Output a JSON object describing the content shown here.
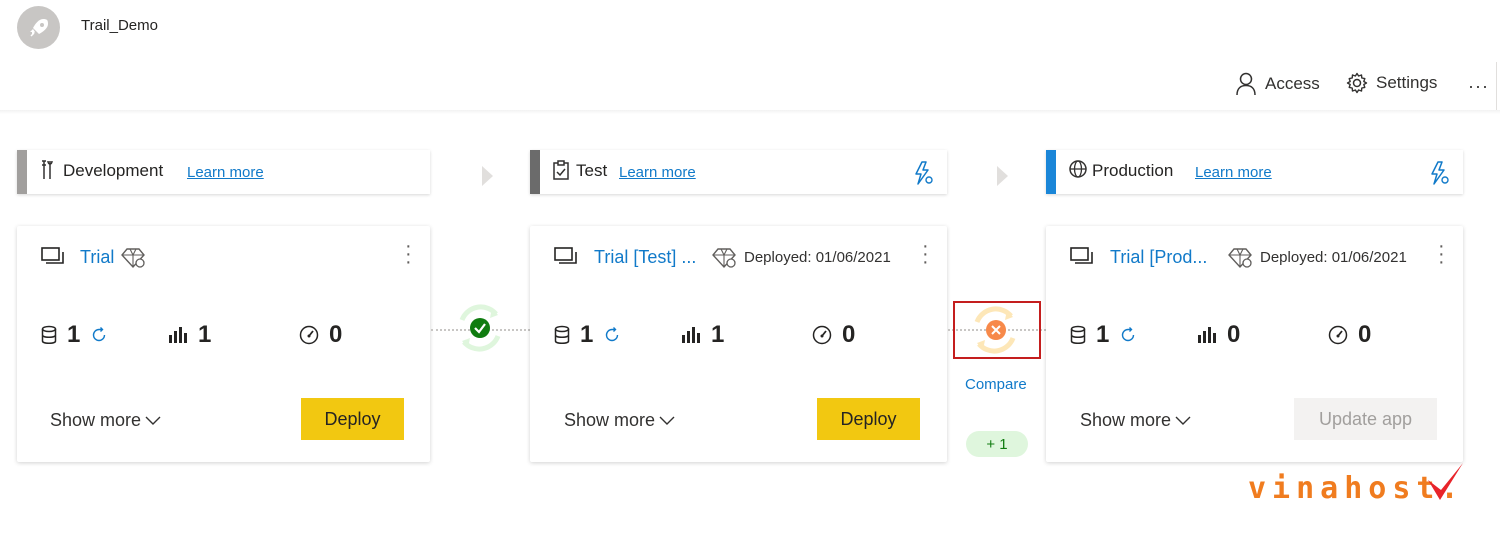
{
  "header": {
    "app_title": "Trail_Demo",
    "access_label": "Access",
    "settings_label": "Settings",
    "more_label": "···"
  },
  "stages": [
    {
      "name": "Development",
      "learn_more": "Learn more",
      "color": "#a19f9d"
    },
    {
      "name": "Test",
      "learn_more": "Learn more",
      "color": "#6b6b6b"
    },
    {
      "name": "Production",
      "learn_more": "Learn more",
      "color": "#1a86d8"
    }
  ],
  "cards": [
    {
      "workspace": "Trial",
      "deployed": "",
      "datasets": "1",
      "reports": "1",
      "dashboards": "0",
      "show_more": "Show more",
      "action": "Deploy"
    },
    {
      "workspace": "Trial [Test] ...",
      "deployed": "Deployed: 01/06/2021",
      "datasets": "1",
      "reports": "1",
      "dashboards": "0",
      "show_more": "Show more",
      "action": "Deploy"
    },
    {
      "workspace": "Trial [Prod...",
      "deployed": "Deployed: 01/06/2021",
      "datasets": "1",
      "reports": "0",
      "dashboards": "0",
      "show_more": "Show more",
      "action": "Update app"
    }
  ],
  "compare": {
    "label": "Compare",
    "diff_badge": "+ 1"
  },
  "watermark": "vinahost.",
  "colors": {
    "accent_blue": "#117ac9",
    "deploy_yellow": "#f2c811",
    "success_green": "#107c10",
    "warning_orange": "#f7894a",
    "highlight_red": "#c41e1e"
  }
}
